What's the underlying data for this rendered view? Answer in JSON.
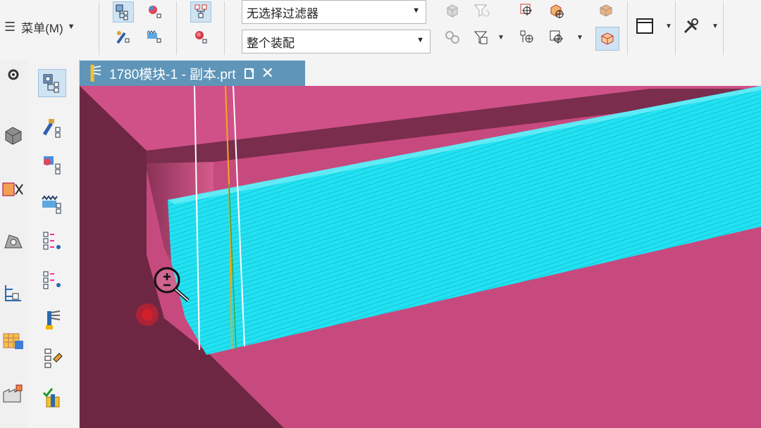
{
  "menu": {
    "label": "菜单(M)"
  },
  "filters": {
    "selection_filter": "无选择过滤器",
    "assembly_scope": "整个装配"
  },
  "tab": {
    "title": "1780模块-1 - 副本.prt"
  },
  "icons": {
    "toolbar": [
      "assembly-navigator-icon",
      "part-navigator-icon",
      "constraint-navigator-icon",
      "reuse-library-icon",
      "hierarchy-icon",
      "component-icon",
      "cube-gray-icon",
      "filter-icon",
      "snap-point-icon",
      "snap-cube-icon",
      "snap-vertex-icon",
      "snap-cursor-icon",
      "wireframe-cube-icon",
      "shaded-cube-icon",
      "window-icon",
      "tools-icon"
    ],
    "leftnav": [
      "assembly-navigator-icon",
      "part-navigator-icon",
      "constraint-navigator-icon",
      "reuse-library-icon",
      "hd3d-tools-icon",
      "history-tree-icon",
      "roles-icon",
      "system-materials-icon",
      "process-studio-icon",
      "check-mate-icon"
    ],
    "lefttool": [
      "settings-gear-icon",
      "solid-block-icon",
      "valve-icon",
      "shape-icon",
      "tree-diagram-icon",
      "grid-table-icon",
      "factory-icon"
    ]
  },
  "colors": {
    "model_pink": "#c74a7e",
    "model_dark_wall": "#6e2743",
    "model_cyan": "#1de3f3",
    "tab_blue": "#5f95b8",
    "selection_blue": "#cfe3f3"
  }
}
